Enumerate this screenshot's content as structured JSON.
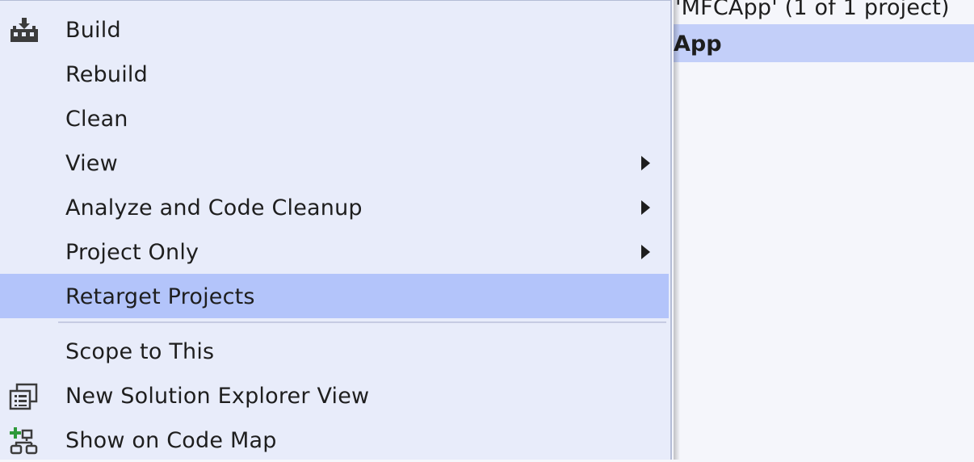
{
  "explorer": {
    "header_text": "'MFCApp' (1 of 1 project)",
    "selected_node": "App"
  },
  "menu": {
    "items": [
      {
        "label": "Build",
        "icon": "build-icon",
        "has_submenu": false
      },
      {
        "label": "Rebuild",
        "has_submenu": false
      },
      {
        "label": "Clean",
        "has_submenu": false
      },
      {
        "label": "View",
        "has_submenu": true
      },
      {
        "label": "Analyze and Code Cleanup",
        "has_submenu": true
      },
      {
        "label": "Project Only",
        "has_submenu": true
      },
      {
        "label": "Retarget Projects",
        "has_submenu": false,
        "highlighted": true
      },
      {
        "label": "Scope to This",
        "has_submenu": false
      },
      {
        "label": "New Solution Explorer View",
        "icon": "new-explorer-view-icon",
        "has_submenu": false
      },
      {
        "label": "Show on Code Map",
        "icon": "code-map-icon",
        "has_submenu": false
      }
    ]
  },
  "colors": {
    "menu_background": "#e8ecfa",
    "highlight": "#b3c4fa",
    "explorer_selection": "#c3cff9",
    "text": "#1e1e1e"
  }
}
